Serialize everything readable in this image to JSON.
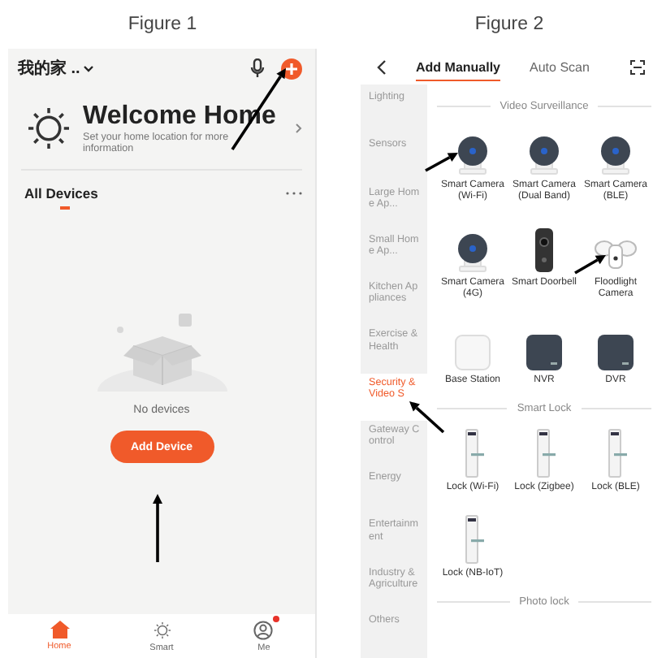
{
  "figure_1": {
    "caption": "Figure 1",
    "home_name": "我的家 ..",
    "welcome_title": "Welcome Home",
    "welcome_text": "Set your home location for more information",
    "section_title": "All Devices",
    "empty_text": "No devices",
    "add_button": "Add Device",
    "nav": [
      {
        "label": "Home",
        "selected": true,
        "notification": false
      },
      {
        "label": "Smart",
        "selected": false,
        "notification": false
      },
      {
        "label": "Me",
        "selected": false,
        "notification": true
      }
    ]
  },
  "figure_2": {
    "caption": "Figure 2",
    "tabs": [
      {
        "label": "Add Manually",
        "selected": true
      },
      {
        "label": "Auto Scan",
        "selected": false
      }
    ],
    "categories": [
      {
        "label": "Lighting",
        "selected": false
      },
      {
        "label": "Sensors",
        "selected": false
      },
      {
        "label": "Large Home Ap...",
        "selected": false
      },
      {
        "label": "Small Home Ap...",
        "selected": false
      },
      {
        "label": "Kitchen Appliances",
        "selected": false
      },
      {
        "label": "Exercise & Health",
        "selected": false
      },
      {
        "label": "Security & Video S",
        "selected": true
      },
      {
        "label": "Gateway Control",
        "selected": false
      },
      {
        "label": "Energy",
        "selected": false
      },
      {
        "label": "Entertainment",
        "selected": false
      },
      {
        "label": "Industry & Agriculture",
        "selected": false
      },
      {
        "label": "Others",
        "selected": false
      }
    ],
    "sections": [
      {
        "title": "Video Surveillance",
        "devices": [
          {
            "name": "Smart Camera (Wi-Fi)",
            "kind": "camera"
          },
          {
            "name": "Smart Camera (Dual Band)",
            "kind": "camera"
          },
          {
            "name": "Smart Camera (BLE)",
            "kind": "camera"
          },
          {
            "name": "Smart Camera (4G)",
            "kind": "camera"
          },
          {
            "name": "Smart Doorbell",
            "kind": "doorbell"
          },
          {
            "name": "Floodlight Camera",
            "kind": "floodlight"
          },
          {
            "name": "Base Station",
            "kind": "base"
          },
          {
            "name": "NVR",
            "kind": "recorder"
          },
          {
            "name": "DVR",
            "kind": "recorder"
          }
        ]
      },
      {
        "title": "Smart Lock",
        "devices": [
          {
            "name": "Lock (Wi-Fi)",
            "kind": "lock"
          },
          {
            "name": "Lock (Zigbee)",
            "kind": "lock"
          },
          {
            "name": "Lock (BLE)",
            "kind": "lock"
          },
          {
            "name": "Lock (NB-IoT)",
            "kind": "lock"
          }
        ]
      },
      {
        "title": "Photo lock"
      }
    ]
  }
}
